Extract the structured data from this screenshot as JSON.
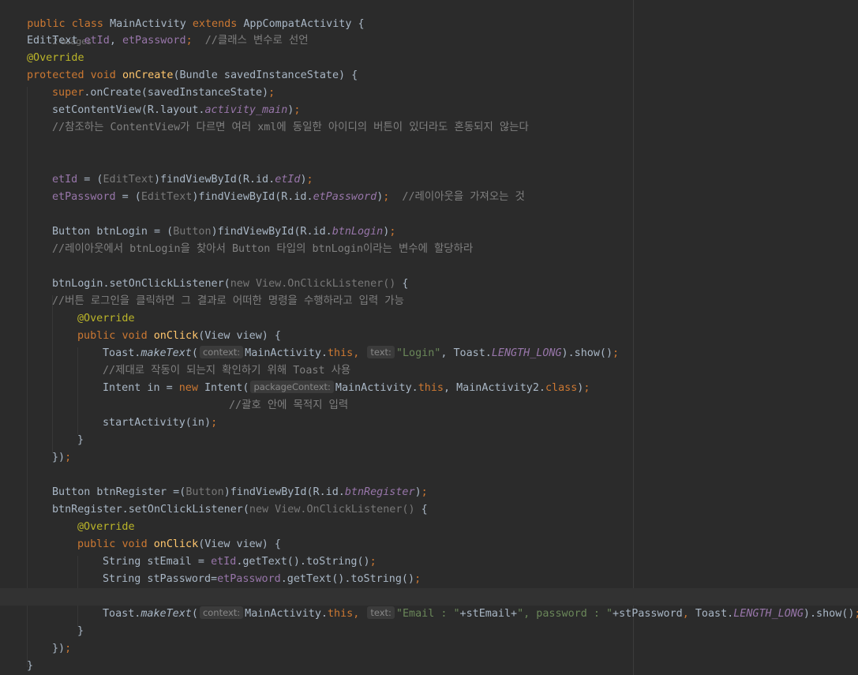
{
  "editor": {
    "class_decl": {
      "kw1": "public",
      "kw2": "class",
      "name": "MainActivity",
      "kw3": "extends",
      "parent": "AppCompatActivity",
      "brace": "{"
    },
    "usages": "2 usages",
    "field_decl": {
      "type": "EditText ",
      "f1": "etId",
      "comma": ", ",
      "f2": "etPassword",
      "semi": ";  ",
      "comment": "//클래스 변수로 선언"
    },
    "override1": "@Override",
    "oncreate_sig": {
      "kw1": "protected",
      "kw2": "void",
      "name": "onCreate",
      "rest": "(Bundle savedInstanceState) {"
    },
    "super_call": {
      "kw": "super",
      "rest": ".onCreate(savedInstanceState)",
      "semi": ";"
    },
    "setcontent": {
      "a": "setContentView(R.layout.",
      "b": "activity_main",
      "c": ")",
      "semi": ";"
    },
    "comment_ref": "//참조하는 ContentView가 다르면 여러 xml에 동일한 아이디의 버튼이 있더라도 혼동되지 않는다",
    "etid_assign": {
      "f": "etId",
      "a": " = (",
      "cast": "EditText",
      "b": ")findViewById(R.id.",
      "id": "etId",
      "c": ")",
      "semi": ";"
    },
    "etpw_assign": {
      "f": "etPassword",
      "a": " = (",
      "cast": "EditText",
      "b": ")findViewById(R.id.",
      "id": "etPassword",
      "c": ")",
      "semi": ";",
      "cmt": "  //레이아웃을 가져오는 것"
    },
    "btnlogin_decl": {
      "a": "Button btnLogin = (",
      "cast": "Button",
      "b": ")findViewById(R.id.",
      "id": "btnLogin",
      "c": ")",
      "semi": ";"
    },
    "comment_layout": "//레이아웃에서 btnLogin을 찾아서 Button 타입의 btnLogin이라는 변수에 할당하라",
    "login_listener": {
      "a": "btnLogin.setOnClickListener(",
      "b": "new View.OnClickListener()",
      "c": " {"
    },
    "comment_login": "//버튼 로그인을 클릭하면 그 결과로 어떠한 명령을 수행하라고 입력 가능",
    "override2": "@Override",
    "onclick1_sig": {
      "kw1": "public",
      "kw2": "void",
      "name": "onClick",
      "rest": "(View view) {"
    },
    "toast1": {
      "a": "Toast.",
      "m": "makeText",
      "b": "(",
      "hint1": "context:",
      "c": "MainActivity.",
      "kw": "this",
      "comma": ", ",
      "hint2": "text:",
      "str": "\"Login\"",
      "d": ", Toast.",
      "const": "LENGTH_LONG",
      "e": ").show()",
      "semi": ";"
    },
    "comment_toast": "//제대로 작동이 되는지 확인하기 위해 Toast 사용",
    "intent": {
      "a": "Intent in = ",
      "kw": "new",
      "b": " Intent(",
      "hint": "packageContext:",
      "c": "MainActivity.",
      "kw2": "this",
      "d": ", MainActivity2.",
      "kw3": "class",
      "e": ")",
      "semi": ";"
    },
    "comment_paren": "//괄호 안에 목적지 입력",
    "start_activity": {
      "a": "startActivity(in)",
      "semi": ";"
    },
    "close1": "}",
    "close2": {
      "a": "})",
      "semi": ";"
    },
    "btnreg_decl": {
      "a": "Button btnRegister =(",
      "cast": "Button",
      "b": ")findViewById(R.id.",
      "id": "btnRegister",
      "c": ")",
      "semi": ";"
    },
    "reg_listener": {
      "a": "btnRegister.setOnClickListener(",
      "b": "new View.OnClickListener()",
      "c": " {"
    },
    "override3": "@Override",
    "onclick2_sig": {
      "kw1": "public",
      "kw2": "void",
      "name": "onClick",
      "rest": "(View view) {"
    },
    "stemail": {
      "a": "String stEmail = ",
      "f": "etId",
      "b": ".getText().toString()",
      "semi": ";"
    },
    "stpassword": {
      "a": "String stPassword=",
      "f": "etPassword",
      "b": ".getText().toString()",
      "semi": ";"
    },
    "toast2": {
      "a": "Toast.",
      "m": "makeText",
      "b": "(",
      "hint1": "context:",
      "c": "MainActivity.",
      "kw": "this",
      "comma": ", ",
      "hint2": "text:",
      "s1": "\"Email : \"",
      "d": "+stEmail+",
      "s2": "\", password : \"",
      "e": "+stPassword",
      "comma2": ", ",
      "f": "Toast.",
      "const": "LENGTH_LONG",
      "g": ").show()",
      "semi": ";"
    },
    "close3": "}",
    "close4": {
      "a": "})",
      "semi": ";"
    },
    "close5": "}"
  }
}
